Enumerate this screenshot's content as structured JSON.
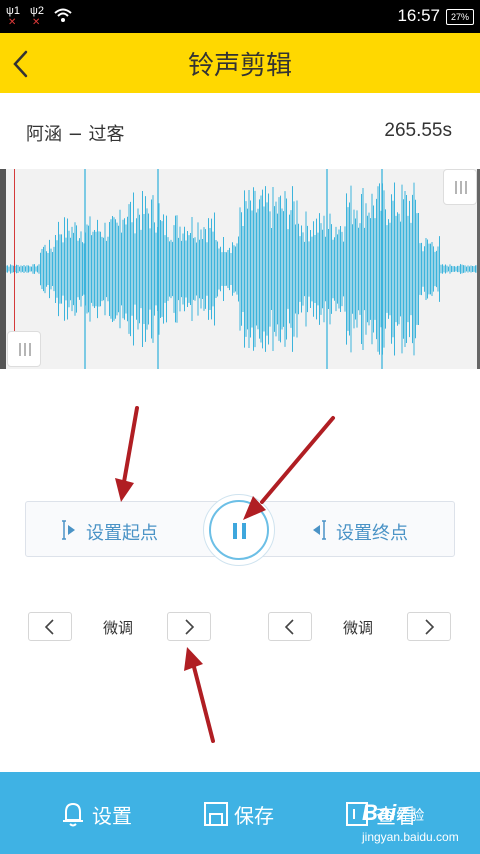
{
  "status_bar": {
    "sim1": "1",
    "sim2": "2",
    "time": "16:57",
    "battery": "27%"
  },
  "header": {
    "title": "铃声剪辑"
  },
  "song": {
    "name": "阿涵 − 过客",
    "duration": "265.55s"
  },
  "controls": {
    "set_start": "设置起点",
    "set_end": "设置终点",
    "fine_tune_left": "微调",
    "fine_tune_right": "微调"
  },
  "bottom_bar": {
    "settings": "设置",
    "save": "保存",
    "view": "查看"
  },
  "watermark": {
    "brand": "Bai",
    "brand_cn": "经验",
    "url": "jingyan.baidu.com"
  },
  "colors": {
    "header_bg": "#ffd800",
    "wave_color": "#3cb4dc",
    "accent_blue": "#4a93c6",
    "bottom_bar_bg": "#3fb2e4",
    "annotation_arrow": "#b01e23"
  }
}
